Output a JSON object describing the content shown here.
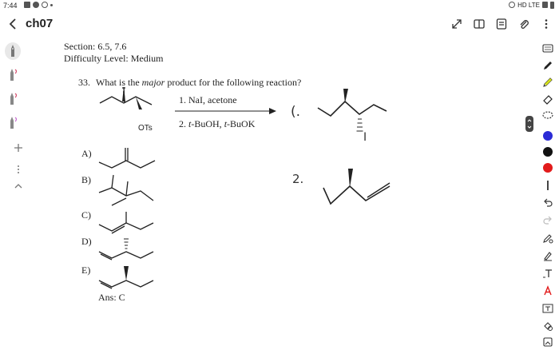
{
  "status_bar": {
    "time": "7:44",
    "right_text": "HD LTE"
  },
  "header": {
    "title": "ch07"
  },
  "document": {
    "section": "Section: 6.5, 7.6",
    "difficulty": "Difficulty Level: Medium",
    "question_number": "33.",
    "question_pre": "What is the",
    "question_em": "major",
    "question_post": "product for the following reaction?",
    "leaving_group": "OTs",
    "step1": "1. NaI, acetone",
    "step2_num": "2.",
    "step2_r1": "t",
    "step2_mid1": "-BuOH,",
    "step2_r2": "t",
    "step2_mid2": "-BuOK",
    "choices": [
      "A)",
      "B)",
      "C)",
      "D)",
      "E)"
    ],
    "answer": "Ans:  C"
  },
  "handwriting": {
    "step1_label": "(.",
    "iodine": "I",
    "step2_label": "2."
  },
  "icons": {
    "back": "chevron-left-icon",
    "expand": "expand-icon",
    "book": "book-icon",
    "list": "list-icon",
    "attach": "paperclip-icon",
    "more": "more-vertical-icon"
  },
  "colors": {
    "blue": "#2b2bd6",
    "black": "#111111",
    "red": "#e21b1b",
    "highlighter": "#d6e21b",
    "pen_pink": "#d44c6c"
  }
}
